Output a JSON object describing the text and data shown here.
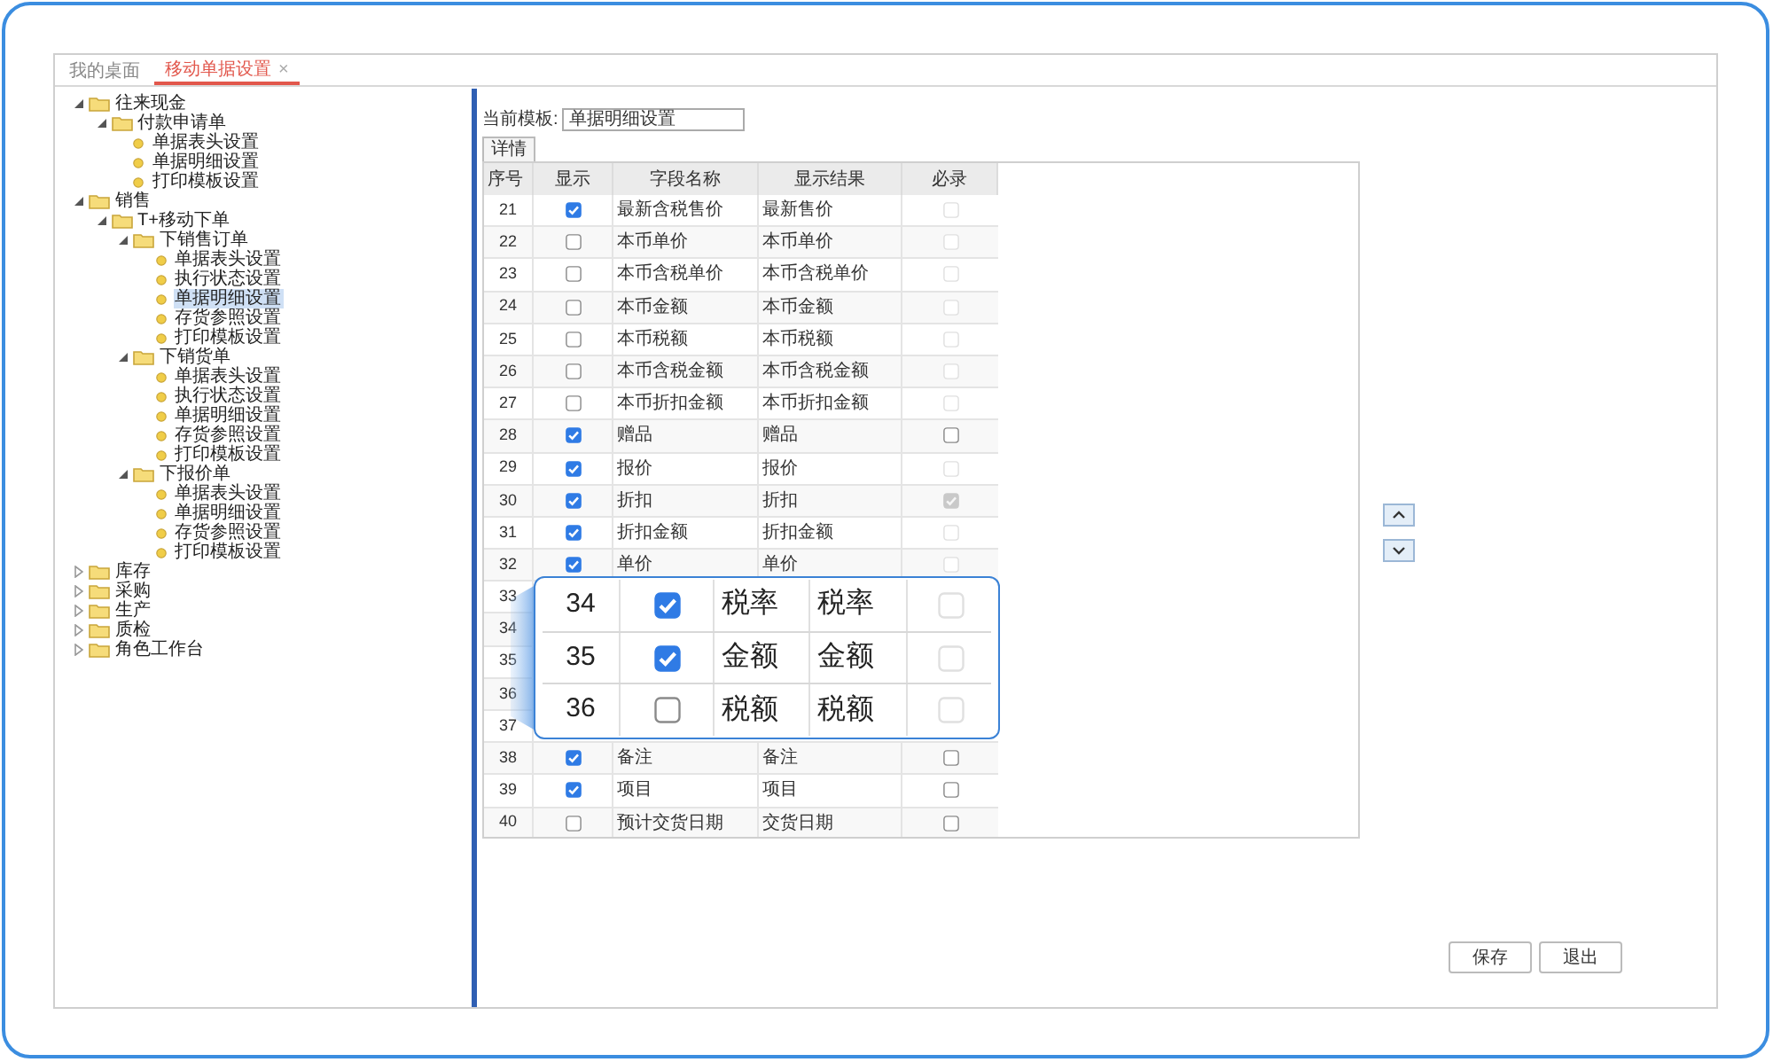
{
  "tabs": [
    {
      "label": "我的桌面",
      "selected": false
    },
    {
      "label": "移动单据设置",
      "selected": true,
      "close": "×"
    }
  ],
  "tree": [
    {
      "label": "往来现金",
      "kind": "folder",
      "expanded": true,
      "children": [
        {
          "label": "付款申请单",
          "kind": "folder",
          "expanded": true,
          "children": [
            {
              "label": "单据表头设置",
              "kind": "leaf",
              "selected": false
            },
            {
              "label": "单据明细设置",
              "kind": "leaf",
              "selected": false
            },
            {
              "label": "打印模板设置",
              "kind": "leaf",
              "selected": false
            }
          ]
        }
      ]
    },
    {
      "label": "销售",
      "kind": "folder",
      "expanded": true,
      "children": [
        {
          "label": "T+移动下单",
          "kind": "folder",
          "expanded": true,
          "children": [
            {
              "label": "下销售订单",
              "kind": "folder",
              "expanded": true,
              "children": [
                {
                  "label": "单据表头设置",
                  "kind": "leaf",
                  "selected": false
                },
                {
                  "label": "执行状态设置",
                  "kind": "leaf",
                  "selected": false
                },
                {
                  "label": "单据明细设置",
                  "kind": "leaf",
                  "selected": true
                },
                {
                  "label": "存货参照设置",
                  "kind": "leaf",
                  "selected": false
                },
                {
                  "label": "打印模板设置",
                  "kind": "leaf",
                  "selected": false
                }
              ]
            },
            {
              "label": "下销货单",
              "kind": "folder",
              "expanded": true,
              "children": [
                {
                  "label": "单据表头设置",
                  "kind": "leaf",
                  "selected": false
                },
                {
                  "label": "执行状态设置",
                  "kind": "leaf",
                  "selected": false
                },
                {
                  "label": "单据明细设置",
                  "kind": "leaf",
                  "selected": false
                },
                {
                  "label": "存货参照设置",
                  "kind": "leaf",
                  "selected": false
                },
                {
                  "label": "打印模板设置",
                  "kind": "leaf",
                  "selected": false
                }
              ]
            },
            {
              "label": "下报价单",
              "kind": "folder",
              "expanded": true,
              "children": [
                {
                  "label": "单据表头设置",
                  "kind": "leaf",
                  "selected": false
                },
                {
                  "label": "单据明细设置",
                  "kind": "leaf",
                  "selected": false
                },
                {
                  "label": "存货参照设置",
                  "kind": "leaf",
                  "selected": false
                },
                {
                  "label": "打印模板设置",
                  "kind": "leaf",
                  "selected": false
                }
              ]
            }
          ]
        }
      ]
    },
    {
      "label": "库存",
      "kind": "folder",
      "expanded": false
    },
    {
      "label": "采购",
      "kind": "folder",
      "expanded": false
    },
    {
      "label": "生产",
      "kind": "folder",
      "expanded": false
    },
    {
      "label": "质检",
      "kind": "folder",
      "expanded": false
    },
    {
      "label": "角色工作台",
      "kind": "folder",
      "expanded": false
    }
  ],
  "template": {
    "label": "当前模板:",
    "value": "单据明细设置"
  },
  "detail_tab": {
    "label": "详情",
    "selected": true
  },
  "table": {
    "columns": [
      "序号",
      "显示",
      "字段名称",
      "显示结果",
      "必录"
    ],
    "rows": [
      {
        "kind": "row",
        "seq": "21",
        "show": true,
        "field": "最新含税售价",
        "result": "最新售价",
        "required": false,
        "required_disabled": true
      },
      {
        "kind": "row",
        "seq": "22",
        "show": false,
        "field": "本币单价",
        "result": "本币单价",
        "required": false,
        "required_disabled": true
      },
      {
        "kind": "row",
        "seq": "23",
        "show": false,
        "field": "本币含税单价",
        "result": "本币含税单价",
        "required": false,
        "required_disabled": true
      },
      {
        "kind": "row",
        "seq": "24",
        "show": false,
        "field": "本币金额",
        "result": "本币金额",
        "required": false,
        "required_disabled": true
      },
      {
        "kind": "row",
        "seq": "25",
        "show": false,
        "field": "本币税额",
        "result": "本币税额",
        "required": false,
        "required_disabled": true
      },
      {
        "kind": "row",
        "seq": "26",
        "show": false,
        "field": "本币含税金额",
        "result": "本币含税金额",
        "required": false,
        "required_disabled": true
      },
      {
        "kind": "row",
        "seq": "27",
        "show": false,
        "field": "本币折扣金额",
        "result": "本币折扣金额",
        "required": false,
        "required_disabled": true
      },
      {
        "kind": "row",
        "seq": "28",
        "show": true,
        "field": "赠品",
        "result": "赠品",
        "required": false,
        "required_disabled": false
      },
      {
        "kind": "row",
        "seq": "29",
        "show": true,
        "field": "报价",
        "result": "报价",
        "required": false,
        "required_disabled": true
      },
      {
        "kind": "row",
        "seq": "30",
        "show": true,
        "field": "折扣",
        "result": "折扣",
        "required": true,
        "required_disabled": true
      },
      {
        "kind": "row",
        "seq": "31",
        "show": true,
        "field": "折扣金额",
        "result": "折扣金额",
        "required": false,
        "required_disabled": true
      },
      {
        "kind": "row",
        "seq": "32",
        "show": true,
        "field": "单价",
        "result": "单价",
        "required": false,
        "required_disabled": true
      },
      {
        "kind": "covered",
        "seq": "33"
      },
      {
        "kind": "covered",
        "seq": "34"
      },
      {
        "kind": "covered",
        "seq": "35"
      },
      {
        "kind": "covered",
        "seq": "36"
      },
      {
        "kind": "covered",
        "seq": "37"
      },
      {
        "kind": "row",
        "seq": "38",
        "show": true,
        "field": "备注",
        "result": "备注",
        "required": false,
        "required_disabled": false
      },
      {
        "kind": "row",
        "seq": "39",
        "show": true,
        "field": "项目",
        "result": "项目",
        "required": false,
        "required_disabled": false
      },
      {
        "kind": "row",
        "seq": "40",
        "show": false,
        "field": "预计交货日期",
        "result": "交货日期",
        "required": false,
        "required_disabled": false
      }
    ]
  },
  "magnifier": {
    "rows": [
      {
        "seq": "34",
        "show": true,
        "field": "税率",
        "result": "税率",
        "required": false,
        "required_disabled": true
      },
      {
        "seq": "35",
        "show": true,
        "field": "金额",
        "result": "金额",
        "required": false,
        "required_disabled": true
      },
      {
        "seq": "36",
        "show": false,
        "field": "税额",
        "result": "税额",
        "required": false,
        "required_disabled": true
      }
    ]
  },
  "buttons": [
    "保存",
    "退出"
  ]
}
